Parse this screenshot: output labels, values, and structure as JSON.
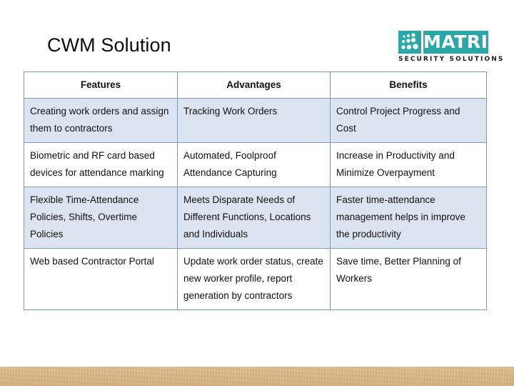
{
  "slide": {
    "title": "CWM Solution"
  },
  "logo": {
    "wordmark": "MATRIX",
    "tagline": "SECURITY SOLUTIONS",
    "brand_color": "#2aa8a8"
  },
  "table": {
    "headers": [
      "Features",
      "Advantages",
      "Benefits"
    ],
    "rows": [
      {
        "features": "Creating work orders and assign them to contractors",
        "advantages": "Tracking Work Orders",
        "benefits": "Control Project Progress and Cost"
      },
      {
        "features": "Biometric and RF card based devices for attendance marking",
        "advantages": "Automated, Foolproof Attendance Capturing",
        "benefits": "Increase in Productivity and Minimize Overpayment"
      },
      {
        "features": "Flexible Time-Attendance Policies, Shifts, Overtime Policies",
        "advantages": "Meets Disparate Needs of Different Functions, Locations and Individuals",
        "benefits": "Faster time-attendance management helps in improve the productivity"
      },
      {
        "features": "Web based Contractor Portal",
        "advantages": "Update work order status, create new worker profile, report generation by contractors",
        "benefits": "Save time, Better Planning of Workers"
      }
    ],
    "border_color": "#7f9bb8",
    "shaded_row_color": "#dce3f1"
  },
  "footer": {
    "band_color": "#d7b484"
  }
}
